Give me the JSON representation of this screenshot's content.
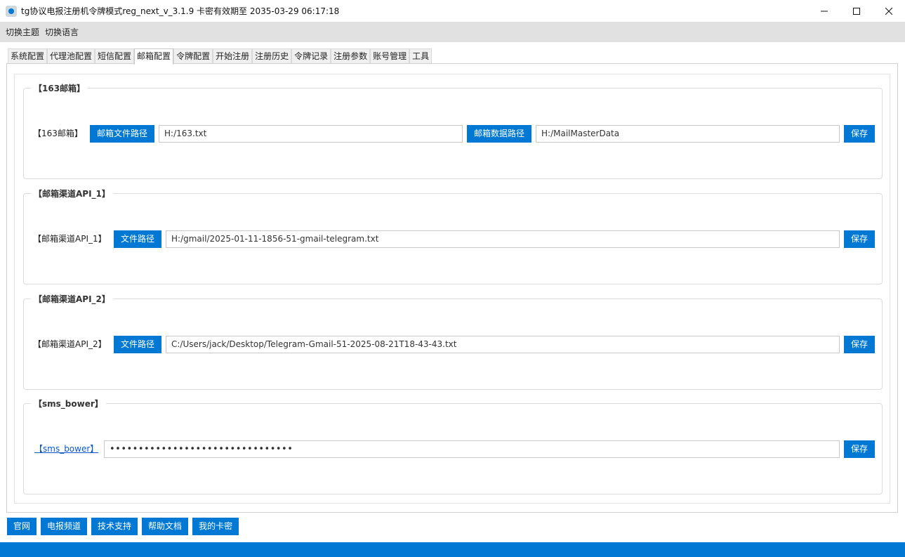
{
  "window": {
    "title": "tg协议电报注册机令牌模式reg_next_v_3.1.9 卡密有效期至 2035-03-29 06:17:18"
  },
  "menu": {
    "items": [
      "切换主题",
      "切换语言"
    ]
  },
  "tabs": [
    "系统配置",
    "代理池配置",
    "短信配置",
    "邮箱配置",
    "令牌配置",
    "开始注册",
    "注册历史",
    "令牌记录",
    "注册参数",
    "账号管理",
    "工具"
  ],
  "active_tab": "邮箱配置",
  "groups": {
    "g163": {
      "legend": "【163邮箱】",
      "label": "【163邮箱】",
      "btn_file_path": "邮箱文件路径",
      "file_path": "H:/163.txt",
      "btn_data_path": "邮箱数据路径",
      "data_path": "H:/MailMasterData",
      "save": "保存"
    },
    "api1": {
      "legend": "【邮箱渠道API_1】",
      "label": "【邮箱渠道API_1】",
      "btn_file_path": "文件路径",
      "file_path": "H:/gmail/2025-01-11-1856-51-gmail-telegram.txt",
      "save": "保存"
    },
    "api2": {
      "legend": "【邮箱渠道API_2】",
      "label": "【邮箱渠道API_2】",
      "btn_file_path": "文件路径",
      "file_path": "C:/Users/jack/Desktop/Telegram-Gmail-51-2025-08-21T18-43-43.txt",
      "save": "保存"
    },
    "sms_bower": {
      "legend": "【sms_bower】",
      "label": "【sms_bower】",
      "api_key_masked": "••••••••••••••••••••••••••••••••",
      "save": "保存"
    }
  },
  "bottom_buttons": [
    "官网",
    "电报频道",
    "技术支持",
    "帮助文档",
    "我的卡密"
  ],
  "colors": {
    "accent": "#0078d4",
    "menubar_bg": "#e1e1e1",
    "link": "#0a58ca"
  }
}
